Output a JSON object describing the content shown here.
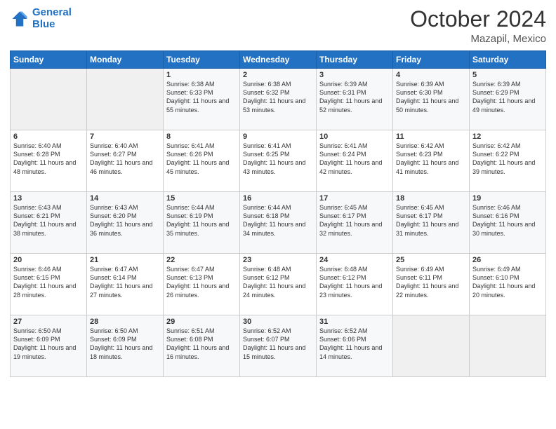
{
  "header": {
    "logo_line1": "General",
    "logo_line2": "Blue",
    "month": "October 2024",
    "location": "Mazapil, Mexico"
  },
  "weekdays": [
    "Sunday",
    "Monday",
    "Tuesday",
    "Wednesday",
    "Thursday",
    "Friday",
    "Saturday"
  ],
  "weeks": [
    [
      {
        "day": "",
        "sunrise": "",
        "sunset": "",
        "daylight": ""
      },
      {
        "day": "",
        "sunrise": "",
        "sunset": "",
        "daylight": ""
      },
      {
        "day": "1",
        "sunrise": "Sunrise: 6:38 AM",
        "sunset": "Sunset: 6:33 PM",
        "daylight": "Daylight: 11 hours and 55 minutes."
      },
      {
        "day": "2",
        "sunrise": "Sunrise: 6:38 AM",
        "sunset": "Sunset: 6:32 PM",
        "daylight": "Daylight: 11 hours and 53 minutes."
      },
      {
        "day": "3",
        "sunrise": "Sunrise: 6:39 AM",
        "sunset": "Sunset: 6:31 PM",
        "daylight": "Daylight: 11 hours and 52 minutes."
      },
      {
        "day": "4",
        "sunrise": "Sunrise: 6:39 AM",
        "sunset": "Sunset: 6:30 PM",
        "daylight": "Daylight: 11 hours and 50 minutes."
      },
      {
        "day": "5",
        "sunrise": "Sunrise: 6:39 AM",
        "sunset": "Sunset: 6:29 PM",
        "daylight": "Daylight: 11 hours and 49 minutes."
      }
    ],
    [
      {
        "day": "6",
        "sunrise": "Sunrise: 6:40 AM",
        "sunset": "Sunset: 6:28 PM",
        "daylight": "Daylight: 11 hours and 48 minutes."
      },
      {
        "day": "7",
        "sunrise": "Sunrise: 6:40 AM",
        "sunset": "Sunset: 6:27 PM",
        "daylight": "Daylight: 11 hours and 46 minutes."
      },
      {
        "day": "8",
        "sunrise": "Sunrise: 6:41 AM",
        "sunset": "Sunset: 6:26 PM",
        "daylight": "Daylight: 11 hours and 45 minutes."
      },
      {
        "day": "9",
        "sunrise": "Sunrise: 6:41 AM",
        "sunset": "Sunset: 6:25 PM",
        "daylight": "Daylight: 11 hours and 43 minutes."
      },
      {
        "day": "10",
        "sunrise": "Sunrise: 6:41 AM",
        "sunset": "Sunset: 6:24 PM",
        "daylight": "Daylight: 11 hours and 42 minutes."
      },
      {
        "day": "11",
        "sunrise": "Sunrise: 6:42 AM",
        "sunset": "Sunset: 6:23 PM",
        "daylight": "Daylight: 11 hours and 41 minutes."
      },
      {
        "day": "12",
        "sunrise": "Sunrise: 6:42 AM",
        "sunset": "Sunset: 6:22 PM",
        "daylight": "Daylight: 11 hours and 39 minutes."
      }
    ],
    [
      {
        "day": "13",
        "sunrise": "Sunrise: 6:43 AM",
        "sunset": "Sunset: 6:21 PM",
        "daylight": "Daylight: 11 hours and 38 minutes."
      },
      {
        "day": "14",
        "sunrise": "Sunrise: 6:43 AM",
        "sunset": "Sunset: 6:20 PM",
        "daylight": "Daylight: 11 hours and 36 minutes."
      },
      {
        "day": "15",
        "sunrise": "Sunrise: 6:44 AM",
        "sunset": "Sunset: 6:19 PM",
        "daylight": "Daylight: 11 hours and 35 minutes."
      },
      {
        "day": "16",
        "sunrise": "Sunrise: 6:44 AM",
        "sunset": "Sunset: 6:18 PM",
        "daylight": "Daylight: 11 hours and 34 minutes."
      },
      {
        "day": "17",
        "sunrise": "Sunrise: 6:45 AM",
        "sunset": "Sunset: 6:17 PM",
        "daylight": "Daylight: 11 hours and 32 minutes."
      },
      {
        "day": "18",
        "sunrise": "Sunrise: 6:45 AM",
        "sunset": "Sunset: 6:17 PM",
        "daylight": "Daylight: 11 hours and 31 minutes."
      },
      {
        "day": "19",
        "sunrise": "Sunrise: 6:46 AM",
        "sunset": "Sunset: 6:16 PM",
        "daylight": "Daylight: 11 hours and 30 minutes."
      }
    ],
    [
      {
        "day": "20",
        "sunrise": "Sunrise: 6:46 AM",
        "sunset": "Sunset: 6:15 PM",
        "daylight": "Daylight: 11 hours and 28 minutes."
      },
      {
        "day": "21",
        "sunrise": "Sunrise: 6:47 AM",
        "sunset": "Sunset: 6:14 PM",
        "daylight": "Daylight: 11 hours and 27 minutes."
      },
      {
        "day": "22",
        "sunrise": "Sunrise: 6:47 AM",
        "sunset": "Sunset: 6:13 PM",
        "daylight": "Daylight: 11 hours and 26 minutes."
      },
      {
        "day": "23",
        "sunrise": "Sunrise: 6:48 AM",
        "sunset": "Sunset: 6:12 PM",
        "daylight": "Daylight: 11 hours and 24 minutes."
      },
      {
        "day": "24",
        "sunrise": "Sunrise: 6:48 AM",
        "sunset": "Sunset: 6:12 PM",
        "daylight": "Daylight: 11 hours and 23 minutes."
      },
      {
        "day": "25",
        "sunrise": "Sunrise: 6:49 AM",
        "sunset": "Sunset: 6:11 PM",
        "daylight": "Daylight: 11 hours and 22 minutes."
      },
      {
        "day": "26",
        "sunrise": "Sunrise: 6:49 AM",
        "sunset": "Sunset: 6:10 PM",
        "daylight": "Daylight: 11 hours and 20 minutes."
      }
    ],
    [
      {
        "day": "27",
        "sunrise": "Sunrise: 6:50 AM",
        "sunset": "Sunset: 6:09 PM",
        "daylight": "Daylight: 11 hours and 19 minutes."
      },
      {
        "day": "28",
        "sunrise": "Sunrise: 6:50 AM",
        "sunset": "Sunset: 6:09 PM",
        "daylight": "Daylight: 11 hours and 18 minutes."
      },
      {
        "day": "29",
        "sunrise": "Sunrise: 6:51 AM",
        "sunset": "Sunset: 6:08 PM",
        "daylight": "Daylight: 11 hours and 16 minutes."
      },
      {
        "day": "30",
        "sunrise": "Sunrise: 6:52 AM",
        "sunset": "Sunset: 6:07 PM",
        "daylight": "Daylight: 11 hours and 15 minutes."
      },
      {
        "day": "31",
        "sunrise": "Sunrise: 6:52 AM",
        "sunset": "Sunset: 6:06 PM",
        "daylight": "Daylight: 11 hours and 14 minutes."
      },
      {
        "day": "",
        "sunrise": "",
        "sunset": "",
        "daylight": ""
      },
      {
        "day": "",
        "sunrise": "",
        "sunset": "",
        "daylight": ""
      }
    ]
  ]
}
